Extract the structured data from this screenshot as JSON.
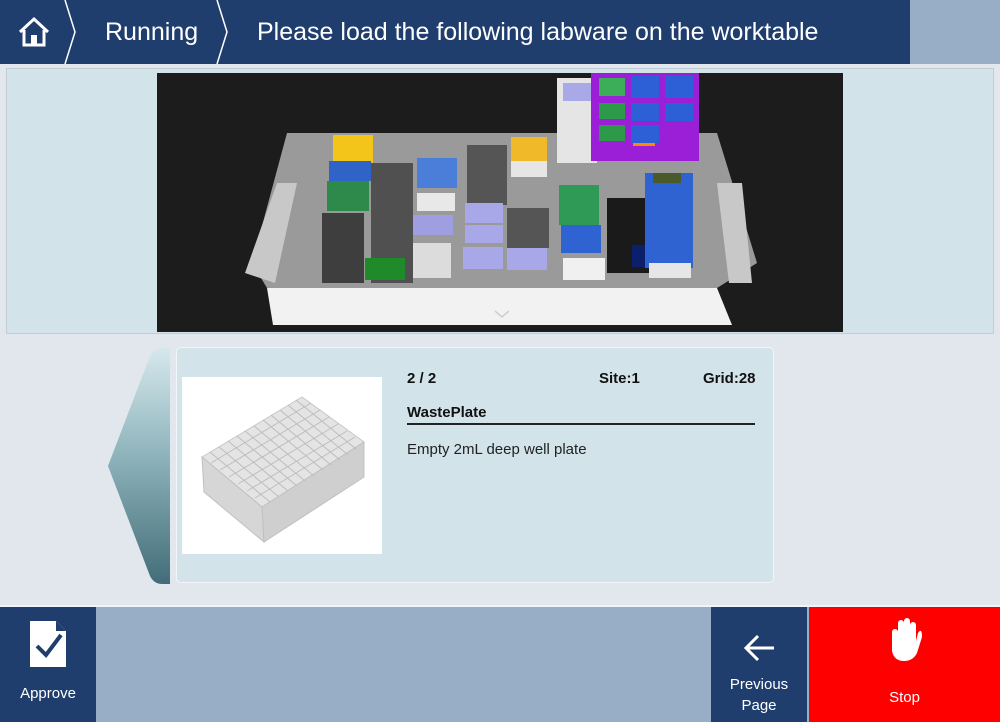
{
  "header": {
    "home_icon": "home-icon",
    "breadcrumb": [
      "Running"
    ],
    "title": "Please load the following labware on the worktable"
  },
  "worktable_view": {
    "expand_icon": "chevron-down-icon"
  },
  "labware_info": {
    "index": "2 / 2",
    "site": "Site:1",
    "grid": "Grid:28",
    "name": "WastePlate",
    "description": "Empty 2mL deep well plate"
  },
  "footer": {
    "approve_label": "Approve",
    "previous_label_1": "Previous",
    "previous_label_2": "Page",
    "stop_label": "Stop"
  },
  "colors": {
    "header_bg": "#1f3e6e",
    "footer_bg": "#98aec6",
    "panel_bg": "#d3e3ea",
    "stop_bg": "#ff0000"
  }
}
